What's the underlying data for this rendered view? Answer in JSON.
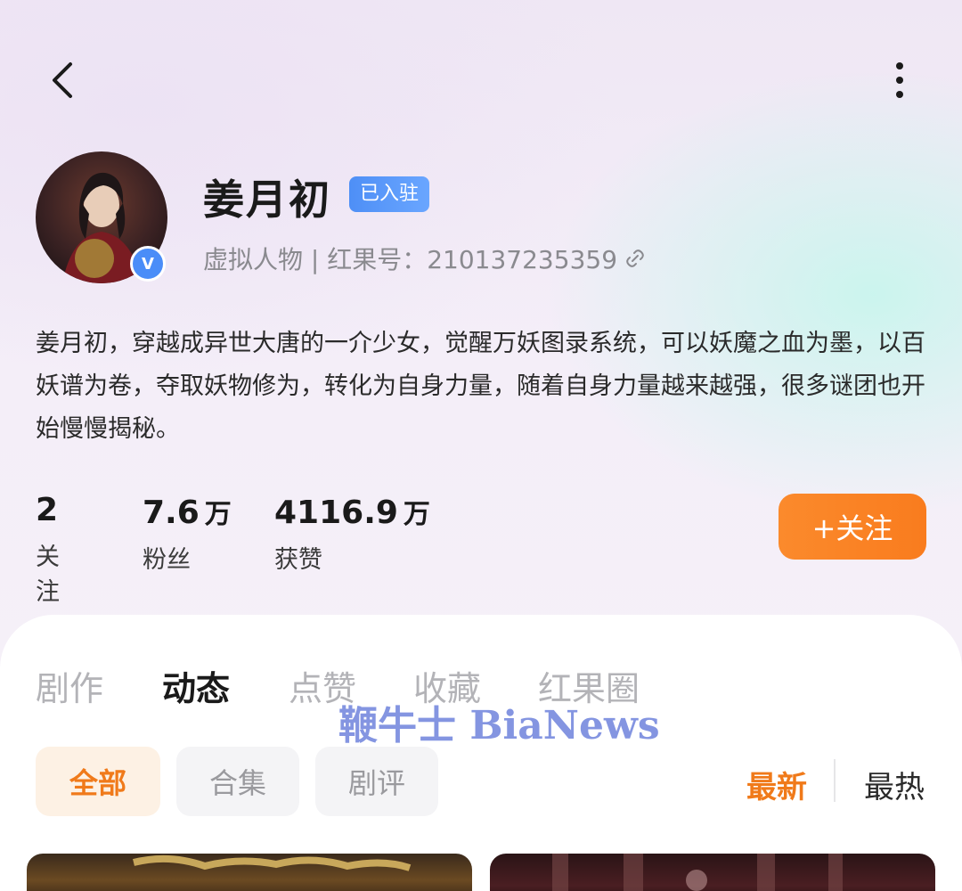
{
  "profile": {
    "name": "姜月初",
    "badge": "已入驻",
    "subtitle": "虚拟人物 | 红果号：210137235359",
    "bio": "姜月初，穿越成异世大唐的一介少女，觉醒万妖图录系统，可以妖魔之血为墨，以百妖谱为卷，夺取妖物修为，转化为自身力量，随着自身力量越来越强，很多谜团也开始慢慢揭秘。",
    "verified_mark": "V"
  },
  "stats": [
    {
      "value": "2",
      "unit": "",
      "label": "关注"
    },
    {
      "value": "7.6",
      "unit": "万",
      "label": "粉丝"
    },
    {
      "value": "4116.9",
      "unit": "万",
      "label": "获赞"
    }
  ],
  "follow_label": "+关注",
  "tabs": [
    "剧作",
    "动态",
    "点赞",
    "收藏",
    "红果圈"
  ],
  "active_tab": "动态",
  "filters": [
    "全部",
    "合集",
    "剧评"
  ],
  "sort": [
    "最新",
    "最热"
  ],
  "watermark": "鞭牛士 BiaNews",
  "icons": {
    "back": "chevron-left-icon",
    "more": "more-vertical-icon",
    "copy": "copy-icon"
  },
  "colors": {
    "accent": "#f97c1e",
    "badge": "#4e8ff6"
  }
}
